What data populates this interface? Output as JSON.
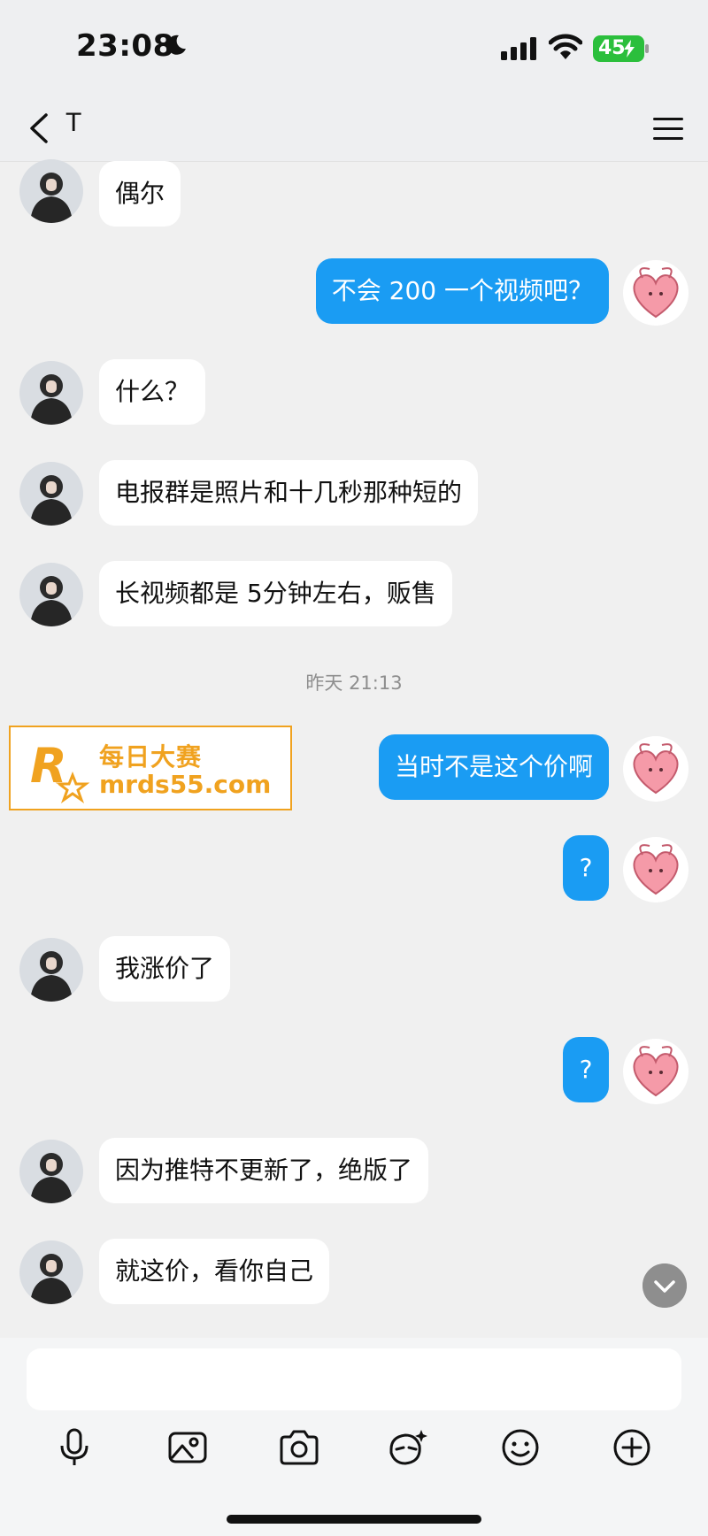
{
  "status_bar": {
    "time": "23:08",
    "battery": "45"
  },
  "nav": {
    "title": "T"
  },
  "messages": [
    {
      "side": "in",
      "text": "偶尔"
    },
    {
      "side": "out",
      "text": "不会 200 一个视频吧？"
    },
    {
      "side": "in",
      "text": "什么？"
    },
    {
      "side": "in",
      "text": "电报群是照片和十几秒那种短的"
    },
    {
      "side": "in",
      "text": "长视频都是 5分钟左右，贩售"
    },
    {
      "side": "timestamp",
      "text": "昨天 21:13"
    },
    {
      "side": "out",
      "text": "当时不是这个价啊"
    },
    {
      "side": "out",
      "text": "?"
    },
    {
      "side": "in",
      "text": "我涨价了"
    },
    {
      "side": "out",
      "text": "?"
    },
    {
      "side": "in",
      "text": "因为推特不更新了，绝版了"
    },
    {
      "side": "in",
      "text": "就这价，看你自己"
    }
  ],
  "watermark": {
    "cn": "每日大赛",
    "url": "mrds55.com",
    "logo_letter": "R",
    "logo_small": "每日大赛"
  },
  "toolbar": [
    "mic-icon",
    "image-icon",
    "camera-icon",
    "ai-sticker-icon",
    "emoji-icon",
    "plus-icon"
  ],
  "colors": {
    "outgoing_bubble": "#1a9cf3",
    "incoming_bubble": "#ffffff",
    "background": "#f0f0f0",
    "watermark": "#f0a21f"
  }
}
